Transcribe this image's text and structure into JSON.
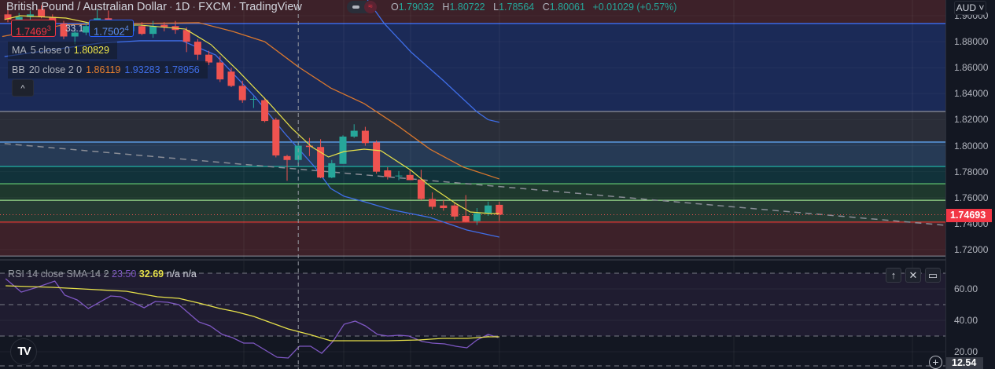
{
  "header": {
    "symbol": "British Pound / Australian Dollar",
    "interval": "1D",
    "exchange": "FXCM",
    "source": "TradingView",
    "ohlc": {
      "o_label": "O",
      "o": "1.79032",
      "h_label": "H",
      "h": "1.80722",
      "l_label": "L",
      "l": "1.78564",
      "c_label": "C",
      "c": "1.80061",
      "change": "+0.01029 (+0.57%)"
    }
  },
  "chips": {
    "sell_main": "1.7469",
    "sell_sup": "3",
    "spread": "33.1",
    "buy_main": "1.7502",
    "buy_sup": "4"
  },
  "legend": {
    "ma": {
      "name": "MA",
      "params": "5 close 0",
      "value": "1.80829"
    },
    "bb": {
      "name": "BB",
      "params": "20 close 2 0",
      "basis": "1.86119",
      "upper": "1.93283",
      "lower": "1.78956"
    },
    "collapse": "^"
  },
  "rsi_legend": {
    "name": "RSI",
    "params": "14 close SMA 14 2",
    "rsi": "23.50",
    "sma": "32.69",
    "na1": "n/a",
    "na2": "n/a"
  },
  "axis": {
    "currency": "AUD ˅",
    "price_ticks": [
      "1.90000",
      "1.88000",
      "1.86000",
      "1.84000",
      "1.82000",
      "1.80000",
      "1.78000",
      "1.76000",
      "1.74000",
      "1.72000"
    ],
    "current_price": "1.74693",
    "rsi_ticks": [
      "60.00",
      "40.00",
      "20.00"
    ],
    "rsi_current": "12.54"
  },
  "pane_buttons": {
    "up": "↑",
    "close": "✕",
    "maximize": "▭"
  },
  "colors": {
    "up": "#26a69a",
    "down": "#ef5350",
    "ma": "#e6e04a",
    "bb_basis": "#d9772e",
    "bb_band": "#3f6ee8",
    "rsi": "#7e57c2",
    "rsi_sma": "#e6e04a"
  },
  "chart_data": {
    "type": "candlestick",
    "title": "British Pound / Australian Dollar · 1D · FXCM",
    "ylim": [
      1.7112,
      1.912
    ],
    "rsi_ylim": [
      10,
      80
    ],
    "crosshair_bar": 26,
    "candles": [
      [
        1.901,
        1.905,
        1.895,
        1.897
      ],
      [
        1.897,
        1.902,
        1.895,
        1.899
      ],
      [
        1.899,
        1.904,
        1.897,
        1.901
      ],
      [
        1.905,
        1.908,
        1.898,
        1.899
      ],
      [
        1.899,
        1.901,
        1.892,
        1.894
      ],
      [
        1.894,
        1.896,
        1.882,
        1.884
      ],
      [
        1.884,
        1.89,
        1.878,
        1.887
      ],
      [
        1.887,
        1.895,
        1.885,
        1.892
      ],
      [
        1.892,
        1.905,
        1.89,
        1.898
      ],
      [
        1.898,
        1.904,
        1.891,
        1.893
      ],
      [
        1.893,
        1.897,
        1.886,
        1.888
      ],
      [
        1.888,
        1.896,
        1.886,
        1.893
      ],
      [
        1.892,
        1.895,
        1.885,
        1.886
      ],
      [
        1.886,
        1.896,
        1.883,
        1.892
      ],
      [
        1.893,
        1.895,
        1.888,
        1.891
      ],
      [
        1.892,
        1.896,
        1.886,
        1.889
      ],
      [
        1.889,
        1.891,
        1.872,
        1.88
      ],
      [
        1.88,
        1.882,
        1.866,
        1.87
      ],
      [
        1.87,
        1.873,
        1.862,
        1.864
      ],
      [
        1.864,
        1.869,
        1.849,
        1.851
      ],
      [
        1.857,
        1.86,
        1.845,
        1.846
      ],
      [
        1.846,
        1.85,
        1.833,
        1.835
      ],
      [
        1.8355,
        1.838,
        1.829,
        1.836
      ],
      [
        1.835,
        1.837,
        1.818,
        1.819
      ],
      [
        1.82,
        1.8215,
        1.791,
        1.7925
      ],
      [
        1.792,
        1.793,
        1.773,
        1.789
      ],
      [
        1.789,
        1.803,
        1.786,
        1.8
      ],
      [
        1.8,
        1.806,
        1.792,
        1.799
      ],
      [
        1.799,
        1.805,
        1.775,
        1.7755
      ],
      [
        1.7755,
        1.789,
        1.775,
        1.7865
      ],
      [
        1.786,
        1.808,
        1.786,
        1.807
      ],
      [
        1.807,
        1.8165,
        1.806,
        1.8115
      ],
      [
        1.8115,
        1.8145,
        1.8,
        1.802
      ],
      [
        1.8025,
        1.804,
        1.7785,
        1.78
      ],
      [
        1.781,
        1.7835,
        1.774,
        1.776
      ],
      [
        1.7765,
        1.7805,
        1.7735,
        1.777
      ],
      [
        1.7775,
        1.781,
        1.7735,
        1.7735
      ],
      [
        1.774,
        1.7815,
        1.758,
        1.759
      ],
      [
        1.759,
        1.764,
        1.751,
        1.753
      ],
      [
        1.754,
        1.758,
        1.75,
        1.752
      ],
      [
        1.754,
        1.756,
        1.743,
        1.7455
      ],
      [
        1.746,
        1.762,
        1.741,
        1.7415
      ],
      [
        1.742,
        1.752,
        1.739,
        1.748
      ],
      [
        1.748,
        1.757,
        1.746,
        1.754
      ],
      [
        1.7545,
        1.757,
        1.742,
        1.7469
      ]
    ],
    "ma5": [
      [
        -0.3,
        1.897
      ],
      [
        1.1,
        1.9
      ],
      [
        5.2,
        1.8982
      ],
      [
        8.2,
        1.8928
      ],
      [
        11.8,
        1.8928
      ],
      [
        15.9,
        1.8897
      ],
      [
        18.2,
        1.8777
      ],
      [
        20.6,
        1.8577
      ],
      [
        23.3,
        1.8336
      ],
      [
        25.4,
        1.8136
      ],
      [
        27.2,
        1.7991
      ],
      [
        28.7,
        1.7913
      ],
      [
        30.1,
        1.7955
      ],
      [
        31.9,
        1.7973
      ],
      [
        33.4,
        1.7961
      ],
      [
        36.1,
        1.781
      ],
      [
        37.8,
        1.7689
      ],
      [
        40.2,
        1.755
      ],
      [
        41.4,
        1.749
      ],
      [
        43.2,
        1.7478
      ],
      [
        44,
        1.7478
      ]
    ],
    "bb_basis": [
      [
        -0.5,
        1.884
      ],
      [
        5,
        1.893
      ],
      [
        11.8,
        1.894
      ],
      [
        17.1,
        1.8946
      ],
      [
        20.1,
        1.888
      ],
      [
        23,
        1.88
      ],
      [
        26,
        1.8607
      ],
      [
        28.9,
        1.8444
      ],
      [
        31.9,
        1.8324
      ],
      [
        34.9,
        1.8154
      ],
      [
        37.8,
        1.7973
      ],
      [
        40.8,
        1.7834
      ],
      [
        44,
        1.7744
      ]
    ],
    "bb_upper": [
      [
        32.2,
        1.912
      ],
      [
        33.7,
        1.894
      ],
      [
        36.1,
        1.872
      ],
      [
        39,
        1.85
      ],
      [
        42,
        1.826
      ],
      [
        43,
        1.82
      ],
      [
        44,
        1.818
      ]
    ],
    "bb_lower": [
      [
        -0.3,
        1.8686
      ],
      [
        8.2,
        1.8789
      ],
      [
        11.8,
        1.8807
      ],
      [
        15.6,
        1.8807
      ],
      [
        18.6,
        1.8698
      ],
      [
        22.1,
        1.8378
      ],
      [
        24.8,
        1.8094
      ],
      [
        27.5,
        1.7834
      ],
      [
        28.9,
        1.7671
      ],
      [
        30.1,
        1.7611
      ],
      [
        31.9,
        1.7569
      ],
      [
        34.3,
        1.7508
      ],
      [
        37.8,
        1.7448
      ],
      [
        41.1,
        1.7351
      ],
      [
        44,
        1.7297
      ]
    ],
    "trendline": [
      [
        -0.3,
        1.8016
      ],
      [
        83.9,
        1.7388
      ]
    ],
    "zones": [
      {
        "top": 1.92,
        "bottom": 1.894,
        "fill": "#3d2129",
        "line": "#3d2129"
      },
      {
        "top": 1.894,
        "bottom": 1.8263,
        "fill": "#1b2a57",
        "line": "#3c6df0"
      },
      {
        "top": 1.8263,
        "bottom": 1.8028,
        "fill": "#2a2d38",
        "line": "#8c8f9a"
      },
      {
        "top": 1.8028,
        "bottom": 1.784,
        "fill": "#263a55",
        "line": "#5fa3f0"
      },
      {
        "top": 1.784,
        "bottom": 1.7707,
        "fill": "#11323a",
        "line": "#1fa39a"
      },
      {
        "top": 1.7707,
        "bottom": 1.758,
        "fill": "#1e382d",
        "line": "#58b56a"
      },
      {
        "top": 1.758,
        "bottom": 1.7412,
        "fill": "#243a32",
        "line": "#9be08e"
      },
      {
        "top": 1.7412,
        "bottom": 1.7151,
        "fill": "#3d2129",
        "line": "#e53935"
      }
    ],
    "zone_bottom_line": 1.7151,
    "rsi": [
      [
        -0.2,
        66.5
      ],
      [
        1.2,
        58
      ],
      [
        2.6,
        61
      ],
      [
        4.2,
        65
      ],
      [
        5.1,
        56
      ],
      [
        6.2,
        53
      ],
      [
        7.2,
        47.5
      ],
      [
        9.2,
        55.5
      ],
      [
        10.1,
        55
      ],
      [
        12.2,
        48
      ],
      [
        13.2,
        52
      ],
      [
        14.3,
        51.5
      ],
      [
        15.3,
        50
      ],
      [
        17.1,
        39
      ],
      [
        18.1,
        36.5
      ],
      [
        19.2,
        31
      ],
      [
        20.1,
        29
      ],
      [
        21.1,
        25.5
      ],
      [
        22,
        25.5
      ],
      [
        24.1,
        16.5
      ],
      [
        25.1,
        16
      ],
      [
        26.1,
        23.5
      ],
      [
        27.1,
        23.5
      ],
      [
        28.1,
        19
      ],
      [
        29.1,
        26.5
      ],
      [
        30.1,
        37.5
      ],
      [
        31.1,
        39.5
      ],
      [
        32,
        36.5
      ],
      [
        33.1,
        31
      ],
      [
        34,
        30
      ],
      [
        35,
        30.5
      ],
      [
        35.9,
        30
      ],
      [
        37.1,
        26.5
      ],
      [
        38,
        25.5
      ],
      [
        39.1,
        25
      ],
      [
        40.1,
        23.5
      ],
      [
        41.1,
        22.5
      ],
      [
        42,
        27.5
      ],
      [
        43,
        31
      ],
      [
        43.9,
        29
      ]
    ],
    "rsi_sma": [
      [
        -0.2,
        62
      ],
      [
        4,
        61
      ],
      [
        10.6,
        58.5
      ],
      [
        13.4,
        55
      ],
      [
        15.3,
        54
      ],
      [
        17.1,
        51
      ],
      [
        19,
        47.5
      ],
      [
        20.4,
        45.5
      ],
      [
        22,
        42.5
      ],
      [
        25.1,
        34.5
      ],
      [
        27,
        31
      ],
      [
        28.9,
        27
      ],
      [
        34,
        27
      ],
      [
        36.8,
        27.5
      ],
      [
        38.9,
        28.5
      ],
      [
        41.1,
        28.5
      ],
      [
        43,
        29.5
      ],
      [
        44,
        29.5
      ]
    ],
    "rsi_levels": [
      70,
      50,
      30,
      11
    ]
  }
}
